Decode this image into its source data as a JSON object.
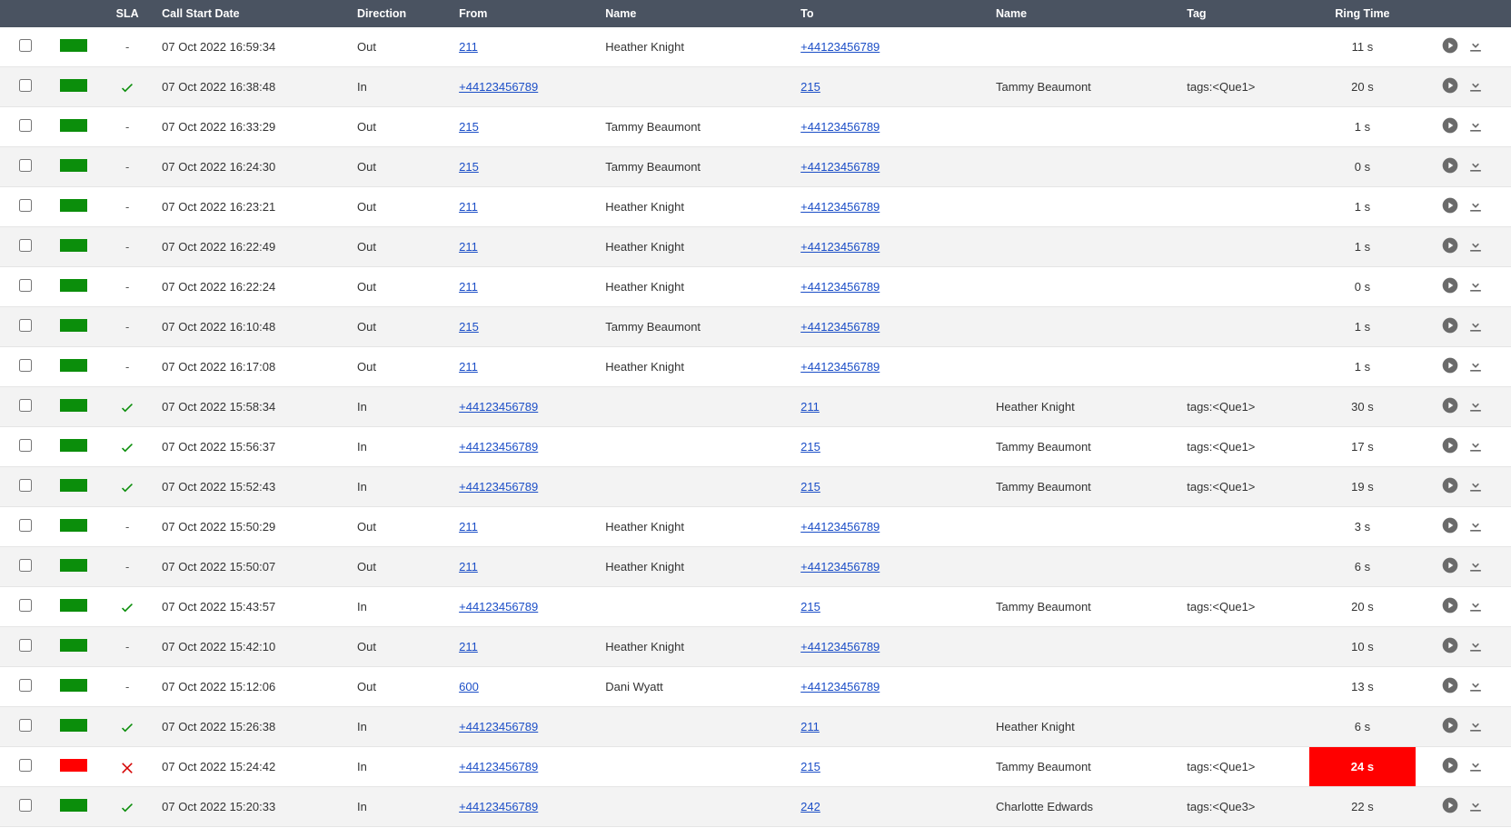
{
  "headers": {
    "checkbox": "",
    "status": "",
    "sla": "SLA",
    "call_start": "Call Start Date",
    "direction": "Direction",
    "from": "From",
    "name1": "Name",
    "to": "To",
    "name2": "Name",
    "tag": "Tag",
    "ring_time": "Ring Time",
    "actions": ""
  },
  "rows": [
    {
      "status": "green",
      "sla": "dash",
      "date": "07 Oct 2022 16:59:34",
      "dir": "Out",
      "from": "211",
      "name1": "Heather Knight",
      "to": "+44123456789",
      "name2": "",
      "tag": "",
      "ring": "11 s",
      "ring_danger": false
    },
    {
      "status": "green",
      "sla": "check",
      "date": "07 Oct 2022 16:38:48",
      "dir": "In",
      "from": "+44123456789",
      "name1": "",
      "to": "215",
      "name2": "Tammy Beaumont",
      "tag": "tags:<Que1>",
      "ring": "20 s",
      "ring_danger": false
    },
    {
      "status": "green",
      "sla": "dash",
      "date": "07 Oct 2022 16:33:29",
      "dir": "Out",
      "from": "215",
      "name1": "Tammy Beaumont",
      "to": "+44123456789",
      "name2": "",
      "tag": "",
      "ring": "1 s",
      "ring_danger": false
    },
    {
      "status": "green",
      "sla": "dash",
      "date": "07 Oct 2022 16:24:30",
      "dir": "Out",
      "from": "215",
      "name1": "Tammy Beaumont",
      "to": "+44123456789",
      "name2": "",
      "tag": "",
      "ring": "0 s",
      "ring_danger": false
    },
    {
      "status": "green",
      "sla": "dash",
      "date": "07 Oct 2022 16:23:21",
      "dir": "Out",
      "from": "211",
      "name1": "Heather Knight",
      "to": "+44123456789",
      "name2": "",
      "tag": "",
      "ring": "1 s",
      "ring_danger": false
    },
    {
      "status": "green",
      "sla": "dash",
      "date": "07 Oct 2022 16:22:49",
      "dir": "Out",
      "from": "211",
      "name1": "Heather Knight",
      "to": "+44123456789",
      "name2": "",
      "tag": "",
      "ring": "1 s",
      "ring_danger": false
    },
    {
      "status": "green",
      "sla": "dash",
      "date": "07 Oct 2022 16:22:24",
      "dir": "Out",
      "from": "211",
      "name1": "Heather Knight",
      "to": "+44123456789",
      "name2": "",
      "tag": "",
      "ring": "0 s",
      "ring_danger": false
    },
    {
      "status": "green",
      "sla": "dash",
      "date": "07 Oct 2022 16:10:48",
      "dir": "Out",
      "from": "215",
      "name1": "Tammy Beaumont",
      "to": "+44123456789",
      "name2": "",
      "tag": "",
      "ring": "1 s",
      "ring_danger": false
    },
    {
      "status": "green",
      "sla": "dash",
      "date": "07 Oct 2022 16:17:08",
      "dir": "Out",
      "from": "211",
      "name1": "Heather Knight",
      "to": "+44123456789",
      "name2": "",
      "tag": "",
      "ring": "1 s",
      "ring_danger": false
    },
    {
      "status": "green",
      "sla": "check",
      "date": "07 Oct 2022 15:58:34",
      "dir": "In",
      "from": "+44123456789",
      "name1": "",
      "to": "211",
      "name2": "Heather Knight",
      "tag": "tags:<Que1>",
      "ring": "30 s",
      "ring_danger": false
    },
    {
      "status": "green",
      "sla": "check",
      "date": "07 Oct 2022 15:56:37",
      "dir": "In",
      "from": "+44123456789",
      "name1": "",
      "to": "215",
      "name2": "Tammy Beaumont",
      "tag": "tags:<Que1>",
      "ring": "17 s",
      "ring_danger": false
    },
    {
      "status": "green",
      "sla": "check",
      "date": "07 Oct 2022 15:52:43",
      "dir": "In",
      "from": "+44123456789",
      "name1": "",
      "to": "215",
      "name2": "Tammy Beaumont",
      "tag": "tags:<Que1>",
      "ring": "19 s",
      "ring_danger": false
    },
    {
      "status": "green",
      "sla": "dash",
      "date": "07 Oct 2022 15:50:29",
      "dir": "Out",
      "from": "211",
      "name1": "Heather Knight",
      "to": "+44123456789",
      "name2": "",
      "tag": "",
      "ring": "3 s",
      "ring_danger": false
    },
    {
      "status": "green",
      "sla": "dash",
      "date": "07 Oct 2022 15:50:07",
      "dir": "Out",
      "from": "211",
      "name1": "Heather Knight",
      "to": "+44123456789",
      "name2": "",
      "tag": "",
      "ring": "6 s",
      "ring_danger": false
    },
    {
      "status": "green",
      "sla": "check",
      "date": "07 Oct 2022 15:43:57",
      "dir": "In",
      "from": "+44123456789",
      "name1": "",
      "to": "215",
      "name2": "Tammy Beaumont",
      "tag": "tags:<Que1>",
      "ring": "20 s",
      "ring_danger": false
    },
    {
      "status": "green",
      "sla": "dash",
      "date": "07 Oct 2022 15:42:10",
      "dir": "Out",
      "from": "211",
      "name1": "Heather Knight",
      "to": "+44123456789",
      "name2": "",
      "tag": "",
      "ring": "10 s",
      "ring_danger": false
    },
    {
      "status": "green",
      "sla": "dash",
      "date": "07 Oct 2022 15:12:06",
      "dir": "Out",
      "from": "600",
      "name1": "Dani Wyatt",
      "to": "+44123456789",
      "name2": "",
      "tag": "",
      "ring": "13 s",
      "ring_danger": false
    },
    {
      "status": "green",
      "sla": "check",
      "date": "07 Oct 2022 15:26:38",
      "dir": "In",
      "from": "+44123456789",
      "name1": "",
      "to": "211",
      "name2": "Heather Knight",
      "tag": "",
      "ring": "6 s",
      "ring_danger": false
    },
    {
      "status": "red",
      "sla": "x",
      "date": "07 Oct 2022 15:24:42",
      "dir": "In",
      "from": "+44123456789",
      "name1": "",
      "to": "215",
      "name2": "Tammy Beaumont",
      "tag": "tags:<Que1>",
      "ring": "24 s",
      "ring_danger": true
    },
    {
      "status": "green",
      "sla": "check",
      "date": "07 Oct 2022 15:20:33",
      "dir": "In",
      "from": "+44123456789",
      "name1": "",
      "to": "242",
      "name2": "Charlotte Edwards",
      "tag": "tags:<Que3>",
      "ring": "22 s",
      "ring_danger": false
    }
  ]
}
